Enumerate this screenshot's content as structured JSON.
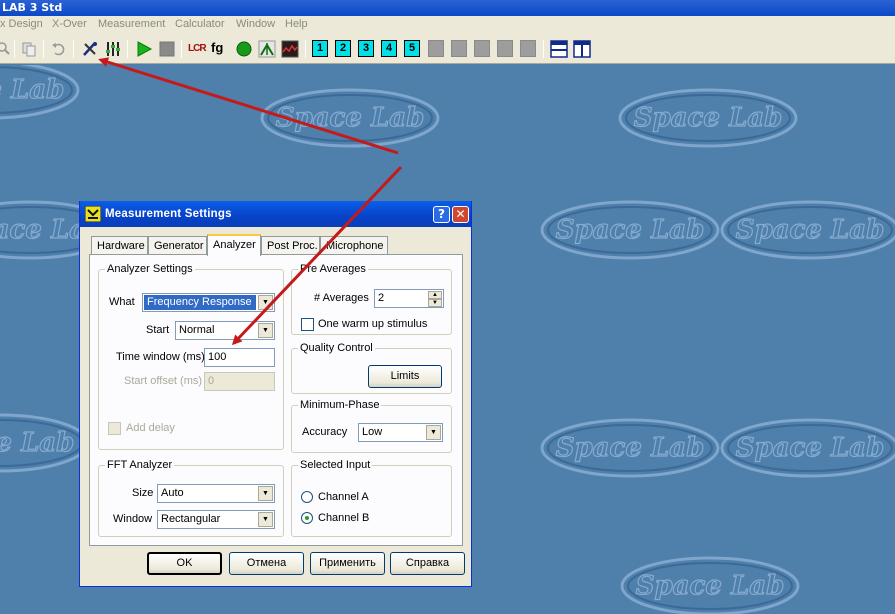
{
  "app": {
    "title": "LAB 3 Std"
  },
  "menu": [
    "x Design",
    "X-Over",
    "Measurement",
    "Calculator",
    "Window",
    "Help"
  ],
  "toolbar": {
    "label_lcr": "LCR",
    "label_fg": "fg",
    "presets": [
      "1",
      "2",
      "3",
      "4",
      "5"
    ]
  },
  "workspace": {
    "watermark": "Space Lab"
  },
  "dialog": {
    "title": "Measurement Settings",
    "help_button": "?",
    "close_button": "✕",
    "tabs": [
      "Hardware",
      "Generator",
      "Analyzer",
      "Post Proc.",
      "Microphone"
    ],
    "active_tab": "Analyzer",
    "analyzer_settings": {
      "legend": "Analyzer Settings",
      "what_label": "What",
      "what_value": "Frequency Response",
      "start_label": "Start",
      "start_value": "Normal",
      "time_window_label": "Time window (ms)",
      "time_window_value": "100",
      "start_offset_label": "Start offset (ms)",
      "start_offset_value": "0",
      "add_delay_label": "Add delay"
    },
    "pre_averages": {
      "legend": "Pre Averages",
      "averages_label": "# Averages",
      "averages_value": "2",
      "warmup_label": "One warm up stimulus"
    },
    "quality_control": {
      "legend": "Quality Control",
      "limits_button": "Limits"
    },
    "minimum_phase": {
      "legend": "Minimum-Phase",
      "accuracy_label": "Accuracy",
      "accuracy_value": "Low"
    },
    "fft_analyzer": {
      "legend": "FFT Analyzer",
      "size_label": "Size",
      "size_value": "Auto",
      "window_label": "Window",
      "window_value": "Rectangular"
    },
    "selected_input": {
      "legend": "Selected Input",
      "channel_a": "Channel A",
      "channel_b": "Channel B",
      "selected": "Channel B"
    },
    "buttons": {
      "ok": "OK",
      "cancel": "Отмена",
      "apply": "Применить",
      "help": "Справка"
    }
  },
  "colors": {
    "arrow": "#c41a1a",
    "workspace": "#4f7fab",
    "title_blue": "#0a50d8",
    "preset_cyan": "#00e0e8"
  }
}
